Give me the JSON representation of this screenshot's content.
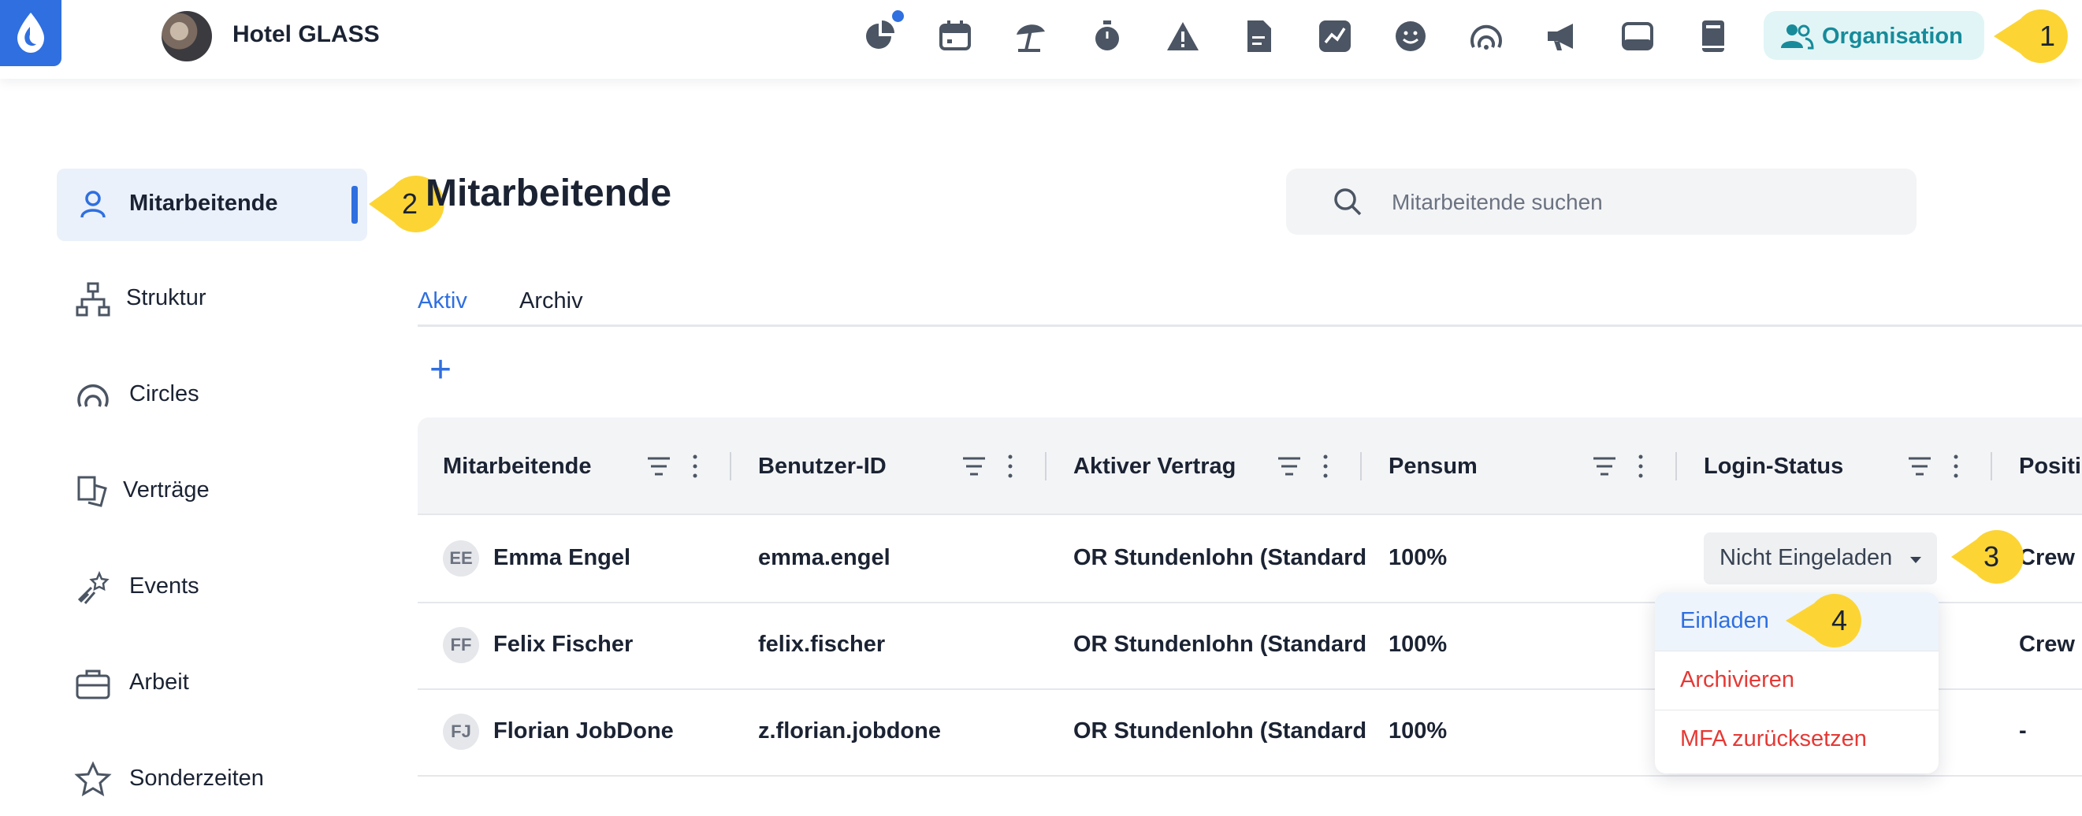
{
  "header": {
    "hotel_name": "Hotel GLASS",
    "icons": [
      "pie-chart-icon",
      "calendar-icon",
      "beach-umbrella-icon",
      "stopwatch-icon",
      "warning-icon",
      "document-icon",
      "trend-chart-icon",
      "smiley-icon",
      "circles-icon",
      "megaphone-icon",
      "inbox-icon",
      "book-icon"
    ],
    "organisation_label": "Organisation",
    "notification_dot_color": "#2f6fe0"
  },
  "callouts": [
    "1",
    "2",
    "3",
    "4"
  ],
  "sidebar": {
    "items": [
      {
        "label": "Mitarbeitende",
        "icon": "user-icon",
        "active": true
      },
      {
        "label": "Struktur",
        "icon": "hierarchy-icon"
      },
      {
        "label": "Circles",
        "icon": "circles-icon"
      },
      {
        "label": "Verträge",
        "icon": "contract-icon"
      },
      {
        "label": "Events",
        "icon": "shooting-star-icon"
      },
      {
        "label": "Arbeit",
        "icon": "briefcase-icon"
      },
      {
        "label": "Sonderzeiten",
        "icon": "star-icon"
      }
    ]
  },
  "main": {
    "title": "Mitarbeitende",
    "search_placeholder": "Mitarbeitende suchen",
    "tabs": [
      {
        "label": "Aktiv",
        "active": true
      },
      {
        "label": "Archiv"
      }
    ],
    "add_label": "+",
    "columns": [
      "Mitarbeitende",
      "Benutzer-ID",
      "Aktiver Vertrag",
      "Pensum",
      "Login-Status",
      "Positi"
    ],
    "rows": [
      {
        "initials": "EE",
        "name": "Emma Engel",
        "user_id": "emma.engel",
        "contract": "OR Stundenlohn (Standard",
        "pensum": "100%",
        "position": "Crew"
      },
      {
        "initials": "FF",
        "name": "Felix Fischer",
        "user_id": "felix.fischer",
        "contract": "OR Stundenlohn (Standard",
        "pensum": "100%",
        "position": "Crew"
      },
      {
        "initials": "FJ",
        "name": "Florian JobDone",
        "user_id": "z.florian.jobdone",
        "contract": "OR Stundenlohn (Standard",
        "pensum": "100%",
        "position": "-"
      }
    ],
    "login_status_value": "Nicht Eingeladen",
    "menu": [
      {
        "label": "Einladen",
        "color": "#2f6fe0"
      },
      {
        "label": "Archivieren",
        "color": "#e53935"
      },
      {
        "label": "MFA zurücksetzen",
        "color": "#e53935"
      }
    ]
  },
  "colors": {
    "accent": "#2f6fe0",
    "danger": "#e53935",
    "callout": "#fcd535",
    "org_text": "#178b9a"
  }
}
